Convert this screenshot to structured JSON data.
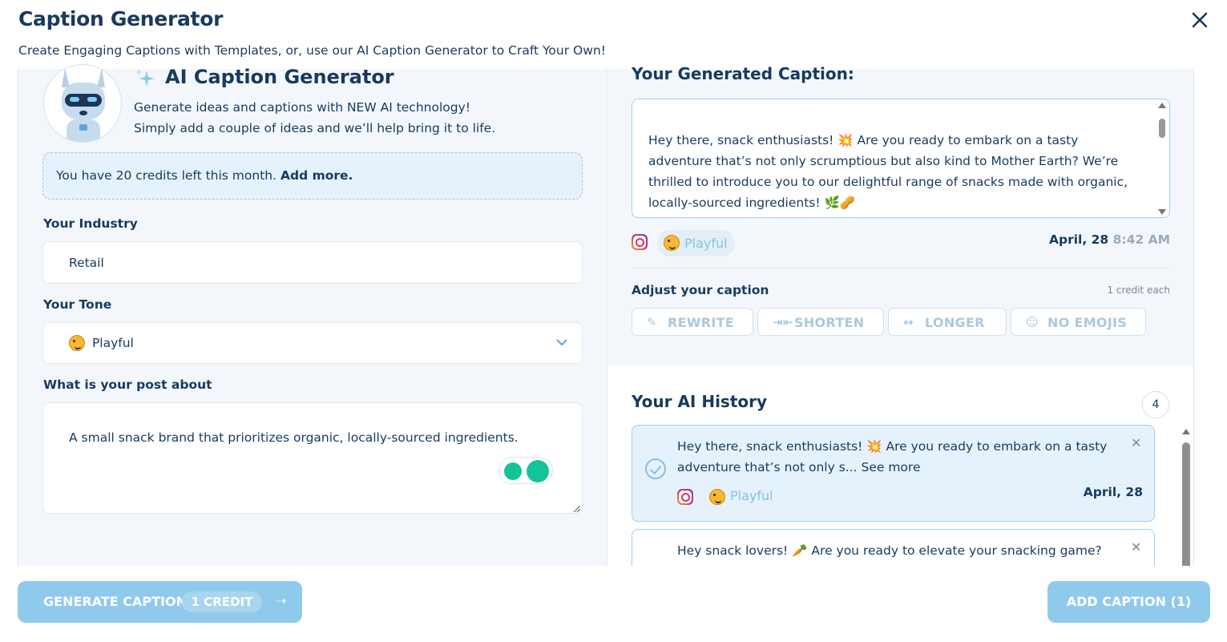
{
  "header": {
    "title": "Caption Generator",
    "subtitle": "Create Engaging Captions with Templates, or, use our AI Caption Generator to Craft Your Own!"
  },
  "ai": {
    "title": "AI Caption Generator",
    "desc_line1": "Generate ideas and captions with NEW AI technology!",
    "desc_line2": "Simply add a couple of ideas and we’ll help bring it to life."
  },
  "credits": {
    "text": "You have 20 credits left this month.",
    "link": "Add more."
  },
  "form": {
    "industry_label": "Your Industry",
    "industry_value": "Retail",
    "tone_label": "Your Tone",
    "tone_value": "Playful",
    "post_label": "What is your post about",
    "post_value": "A small snack brand that prioritizes organic, locally-sourced ingredients."
  },
  "generated": {
    "title": "Your Generated Caption:",
    "text": "Hey there, snack enthusiasts! 💥 Are you ready to embark on a tasty adventure that’s not only scrumptious but also kind to Mother Earth? We’re thrilled to introduce you to our delightful range of snacks made with organic, locally-sourced ingredients! 🌿🥜",
    "tone": "Playful",
    "date": "April, 28",
    "time": "8:42 AM"
  },
  "adjust": {
    "label": "Adjust your caption",
    "cost": "1 credit each",
    "buttons": [
      "REWRITE",
      "SHORTEN",
      "LONGER",
      "NO EMOJIS"
    ]
  },
  "history": {
    "title": "Your AI History",
    "count": "4",
    "items": [
      {
        "text": "Hey there, snack enthusiasts! 💥 Are you ready to embark on a tasty adventure that’s not only s...",
        "see_more": "See more",
        "tone": "Playful",
        "date": "April, 28"
      },
      {
        "text": "Hey snack lovers! 🥕 Are you ready to elevate your snacking game?"
      }
    ]
  },
  "footer": {
    "generate_label": "GENERATE CAPTION",
    "generate_cost": "1 CREDIT",
    "add_label": "ADD CAPTION (1)"
  },
  "colors": {
    "primary_button": "#8fcaec",
    "heading": "#173a5e",
    "accent_border": "#9fd0ea"
  }
}
